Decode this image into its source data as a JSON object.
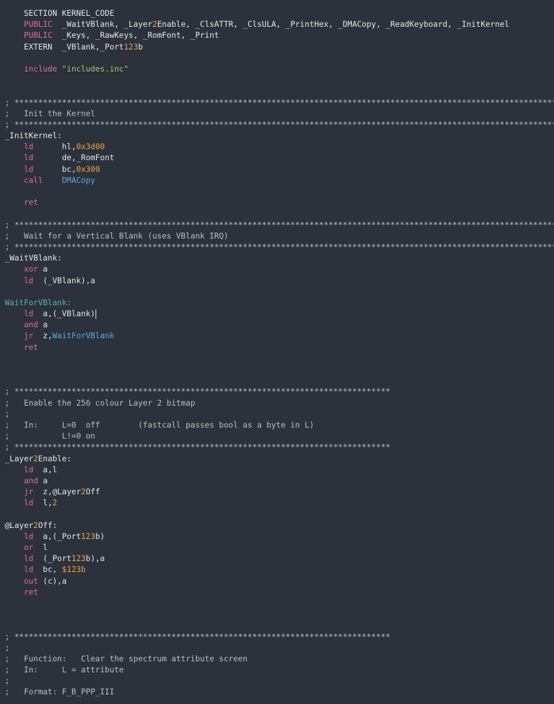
{
  "colors": {
    "background": "#2b323b",
    "text": "#e7e7e7",
    "keyword_pink": "#e06c9f",
    "string_green": "#9ecb65",
    "number_orange": "#f0a34a",
    "function_blue": "#5da9e9",
    "label_teal": "#5bb3b3",
    "comment_grey": "#bfbfbf"
  },
  "code": {
    "lines": [
      [
        {
          "t": "    SECTION KERNEL_CODE",
          "c": "kw"
        }
      ],
      [
        {
          "t": "    PUBLIC",
          "c": "dir"
        },
        {
          "t": "  _WaitVBlank, _Layer",
          "c": "kw"
        },
        {
          "t": "2",
          "c": "num"
        },
        {
          "t": "Enable, _ClsATTR, _ClsULA, _PrintHex, _DMACopy, _ReadKeyboard, _InitKernel",
          "c": "kw"
        }
      ],
      [
        {
          "t": "    PUBLIC",
          "c": "dir"
        },
        {
          "t": "  _Keys, _RawKeys, _RomFont, _Print",
          "c": "kw"
        }
      ],
      [
        {
          "t": "    EXTERN  _VBlank,_Port",
          "c": "kw"
        },
        {
          "t": "123",
          "c": "num"
        },
        {
          "t": "b",
          "c": "kw"
        }
      ],
      [
        {
          "t": "",
          "c": "kw"
        }
      ],
      [
        {
          "t": "    include ",
          "c": "dir"
        },
        {
          "t": "\"includes.inc\"",
          "c": "str"
        }
      ],
      [
        {
          "t": "",
          "c": "kw"
        }
      ],
      [
        {
          "t": "",
          "c": "kw"
        }
      ],
      [
        {
          "t": "; *****************************************************************************************************************************",
          "c": "cmt"
        }
      ],
      [
        {
          "t": ";   Init the Kernel",
          "c": "cmt"
        }
      ],
      [
        {
          "t": "; *****************************************************************************************************************************",
          "c": "cmt"
        }
      ],
      [
        {
          "t": "_InitKernel:",
          "c": "lbl"
        }
      ],
      [
        {
          "t": "    ld      ",
          "c": "ins"
        },
        {
          "t": "hl,",
          "c": "op"
        },
        {
          "t": "0x3d00",
          "c": "num"
        }
      ],
      [
        {
          "t": "    ld      ",
          "c": "ins"
        },
        {
          "t": "de,_RomFont",
          "c": "op"
        }
      ],
      [
        {
          "t": "    ld      ",
          "c": "ins"
        },
        {
          "t": "bc,",
          "c": "op"
        },
        {
          "t": "0x300",
          "c": "num"
        }
      ],
      [
        {
          "t": "    call    ",
          "c": "ins"
        },
        {
          "t": "DMACopy",
          "c": "fn"
        }
      ],
      [
        {
          "t": "",
          "c": "kw"
        }
      ],
      [
        {
          "t": "    ret",
          "c": "ins"
        }
      ],
      [
        {
          "t": "",
          "c": "kw"
        }
      ],
      [
        {
          "t": "; *****************************************************************************************************************************",
          "c": "cmt"
        }
      ],
      [
        {
          "t": ";   Wait for a Vertical Blank (uses VBlank IRQ)",
          "c": "cmt"
        }
      ],
      [
        {
          "t": "; *****************************************************************************************************************************",
          "c": "cmt"
        }
      ],
      [
        {
          "t": "_WaitVBlank:",
          "c": "lbl"
        }
      ],
      [
        {
          "t": "    xor ",
          "c": "ins"
        },
        {
          "t": "a",
          "c": "op"
        }
      ],
      [
        {
          "t": "    ld  ",
          "c": "ins"
        },
        {
          "t": "(_VBlank),a",
          "c": "op"
        }
      ],
      [
        {
          "t": "",
          "c": "kw"
        }
      ],
      [
        {
          "t": "WaitForVBlank:",
          "c": "deflbl"
        }
      ],
      [
        {
          "t": "    ld  ",
          "c": "ins"
        },
        {
          "t": "a,(_VBlank)",
          "c": "op"
        },
        {
          "t": "",
          "c": "caret"
        }
      ],
      [
        {
          "t": "    and ",
          "c": "ins"
        },
        {
          "t": "a",
          "c": "op"
        }
      ],
      [
        {
          "t": "    jr  ",
          "c": "ins"
        },
        {
          "t": "z,",
          "c": "op"
        },
        {
          "t": "WaitForVBlank",
          "c": "fn"
        }
      ],
      [
        {
          "t": "    ret",
          "c": "ins"
        }
      ],
      [
        {
          "t": "",
          "c": "kw"
        }
      ],
      [
        {
          "t": "",
          "c": "kw"
        }
      ],
      [
        {
          "t": "",
          "c": "kw"
        }
      ],
      [
        {
          "t": "; *******************************************************************************",
          "c": "cmt"
        }
      ],
      [
        {
          "t": ";   Enable the 256 colour Layer 2 bitmap",
          "c": "cmt"
        }
      ],
      [
        {
          "t": ";",
          "c": "cmt"
        }
      ],
      [
        {
          "t": ";   In:     L=0  off        (fastcall passes bool as a byte in L)",
          "c": "cmt"
        }
      ],
      [
        {
          "t": ";           L!=0 on",
          "c": "cmt"
        }
      ],
      [
        {
          "t": "; *******************************************************************************",
          "c": "cmt"
        }
      ],
      [
        {
          "t": "_Layer",
          "c": "lbl"
        },
        {
          "t": "2",
          "c": "num"
        },
        {
          "t": "Enable:",
          "c": "lbl"
        }
      ],
      [
        {
          "t": "    ld  ",
          "c": "ins"
        },
        {
          "t": "a,l",
          "c": "op"
        }
      ],
      [
        {
          "t": "    and ",
          "c": "ins"
        },
        {
          "t": "a",
          "c": "op"
        }
      ],
      [
        {
          "t": "    jr  ",
          "c": "ins"
        },
        {
          "t": "z,@Layer",
          "c": "op"
        },
        {
          "t": "2",
          "c": "num"
        },
        {
          "t": "Off",
          "c": "op"
        }
      ],
      [
        {
          "t": "    ld  ",
          "c": "ins"
        },
        {
          "t": "l,",
          "c": "op"
        },
        {
          "t": "2",
          "c": "num"
        }
      ],
      [
        {
          "t": "",
          "c": "kw"
        }
      ],
      [
        {
          "t": "@Layer",
          "c": "lbl"
        },
        {
          "t": "2",
          "c": "num"
        },
        {
          "t": "Off:",
          "c": "lbl"
        }
      ],
      [
        {
          "t": "    ld  ",
          "c": "ins"
        },
        {
          "t": "a,(_Port",
          "c": "op"
        },
        {
          "t": "123",
          "c": "num"
        },
        {
          "t": "b)",
          "c": "op"
        }
      ],
      [
        {
          "t": "    or  ",
          "c": "ins"
        },
        {
          "t": "l",
          "c": "op"
        }
      ],
      [
        {
          "t": "    ld  ",
          "c": "ins"
        },
        {
          "t": "(_Port",
          "c": "op"
        },
        {
          "t": "123",
          "c": "num"
        },
        {
          "t": "b),a",
          "c": "op"
        }
      ],
      [
        {
          "t": "    ld  ",
          "c": "ins"
        },
        {
          "t": "bc, ",
          "c": "op"
        },
        {
          "t": "$123b",
          "c": "num"
        }
      ],
      [
        {
          "t": "    out ",
          "c": "ins"
        },
        {
          "t": "(c),a",
          "c": "op"
        }
      ],
      [
        {
          "t": "    ret",
          "c": "ins"
        }
      ],
      [
        {
          "t": "",
          "c": "kw"
        }
      ],
      [
        {
          "t": "",
          "c": "kw"
        }
      ],
      [
        {
          "t": "",
          "c": "kw"
        }
      ],
      [
        {
          "t": "; *******************************************************************************",
          "c": "cmt"
        }
      ],
      [
        {
          "t": ";",
          "c": "cmt"
        }
      ],
      [
        {
          "t": ";   Function:   Clear the spectrum attribute screen",
          "c": "cmt"
        }
      ],
      [
        {
          "t": ";   In:     L = attribute",
          "c": "cmt"
        }
      ],
      [
        {
          "t": ";",
          "c": "cmt"
        }
      ],
      [
        {
          "t": ";   Format: F_B_PPP_III",
          "c": "cmt"
        }
      ],
      [
        {
          "t": "",
          "c": "kw"
        }
      ]
    ]
  }
}
